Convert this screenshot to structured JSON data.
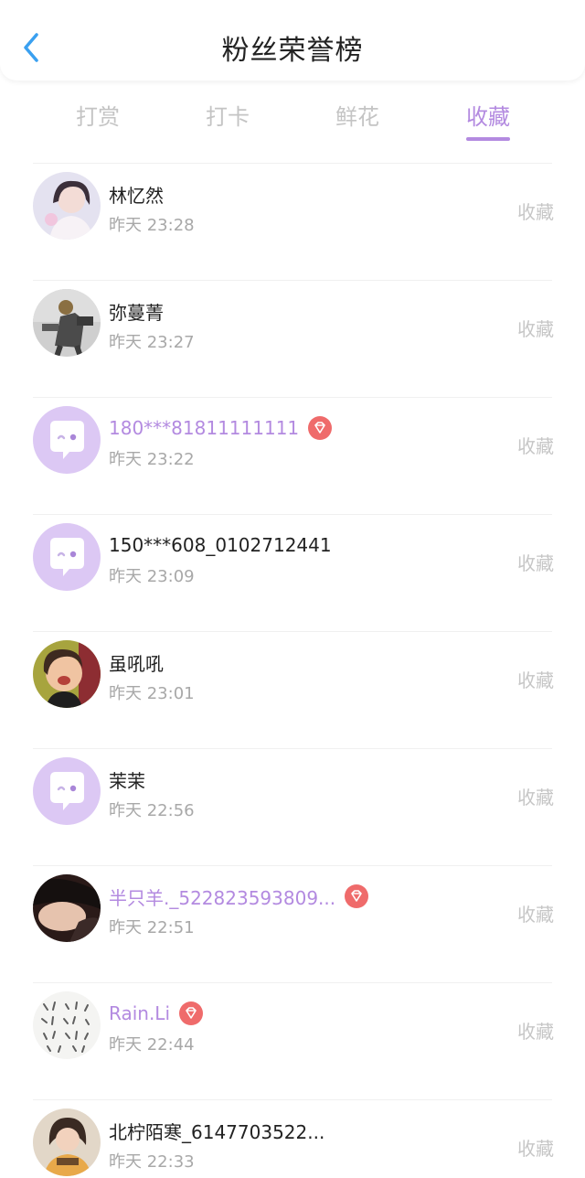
{
  "header": {
    "title": "粉丝荣誉榜"
  },
  "tabs": [
    {
      "label": "打赏",
      "active": false
    },
    {
      "label": "打卡",
      "active": false
    },
    {
      "label": "鲜花",
      "active": false
    },
    {
      "label": "收藏",
      "active": true
    }
  ],
  "colors": {
    "accent": "#b38ae0",
    "vip_badge": "#ef6b6b",
    "default_avatar_bg": "#dcc8f4"
  },
  "fans": [
    {
      "name": "林忆然",
      "time": "昨天 23:28",
      "action": "收藏",
      "vip": false,
      "avatar": "photo-girl"
    },
    {
      "name": "弥蔓菁",
      "time": "昨天 23:27",
      "action": "收藏",
      "vip": false,
      "avatar": "photo-robot"
    },
    {
      "name": "180***81811111111",
      "time": "昨天 23:22",
      "action": "收藏",
      "vip": true,
      "avatar": "default-chat-bubble"
    },
    {
      "name": "150***608_0102712441",
      "time": "昨天 23:09",
      "action": "收藏",
      "vip": false,
      "avatar": "default-chat-bubble"
    },
    {
      "name": "虽吼吼",
      "time": "昨天 23:01",
      "action": "收藏",
      "vip": false,
      "avatar": "photo-child"
    },
    {
      "name": "茉茉",
      "time": "昨天 22:56",
      "action": "收藏",
      "vip": false,
      "avatar": "default-chat-bubble"
    },
    {
      "name": "半只羊._522823593809...",
      "time": "昨天 22:51",
      "action": "收藏",
      "vip": true,
      "avatar": "photo-sleeping"
    },
    {
      "name": "Rain.Li",
      "time": "昨天 22:44",
      "action": "收藏",
      "vip": true,
      "avatar": "photo-sketch"
    },
    {
      "name": "北柠陌寒_6147703522...",
      "time": "昨天 22:33",
      "action": "收藏",
      "vip": false,
      "avatar": "photo-woman"
    }
  ]
}
